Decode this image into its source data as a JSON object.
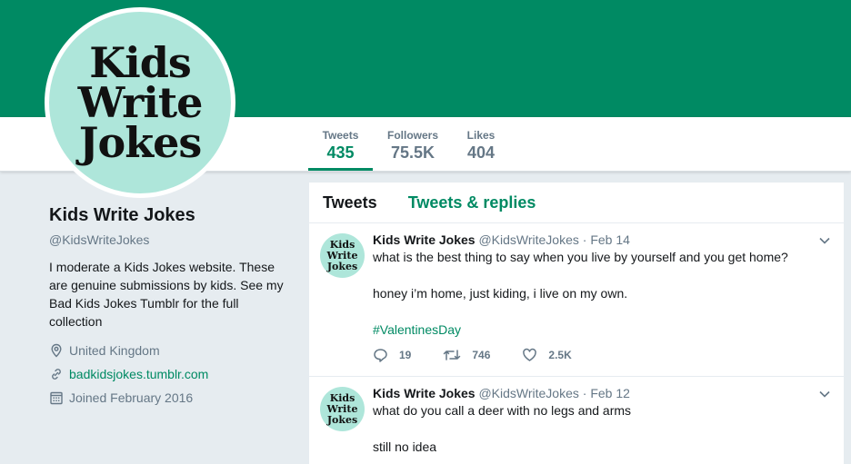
{
  "profile": {
    "avatar_lines": [
      "Kids",
      "Write",
      "Jokes"
    ],
    "name": "Kids Write Jokes",
    "handle": "@KidsWriteJokes",
    "bio": "I moderate a Kids Jokes website. These are genuine submissions by kids. See my Bad Kids Jokes Tumblr for the full collection",
    "location": "United Kingdom",
    "website": "badkidsjokes.tumblr.com",
    "joined": "Joined February 2016"
  },
  "stats": [
    {
      "label": "Tweets",
      "value": "435"
    },
    {
      "label": "Followers",
      "value": "75.5K"
    },
    {
      "label": "Likes",
      "value": "404"
    }
  ],
  "tabs": [
    "Tweets",
    "Tweets & replies"
  ],
  "tweets": [
    {
      "name": "Kids Write Jokes",
      "handle": "@KidsWriteJokes",
      "date": "· Feb 14",
      "line1": "what is the best thing to say when you live by yourself and you get home?",
      "line2": "honey i’m home, just kiding, i live on my own.",
      "hashtag": "#ValentinesDay",
      "replies": "19",
      "retweets": "746",
      "likes": "2.5K"
    },
    {
      "name": "Kids Write Jokes",
      "handle": "@KidsWriteJokes",
      "date": "· Feb 12",
      "line1": "what do you call a deer with no legs and arms",
      "line2": "still no idea"
    }
  ],
  "colors": {
    "brand": "#008a63",
    "avatar_bg": "#aee6da",
    "page_bg": "#e6ecf0"
  }
}
